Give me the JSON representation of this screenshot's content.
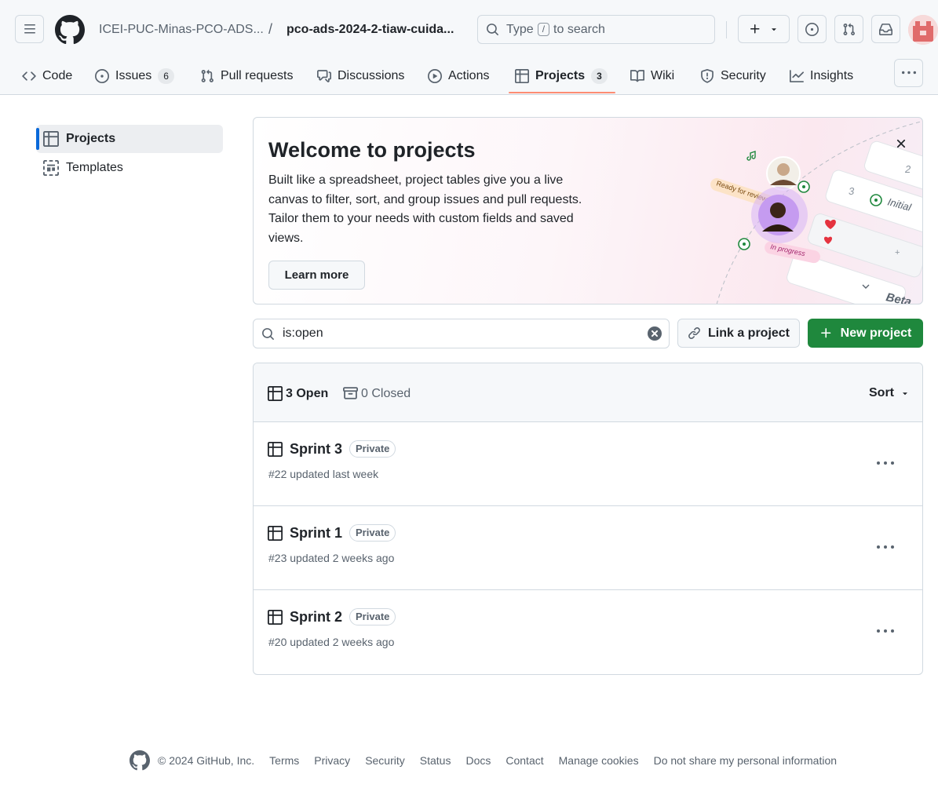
{
  "header": {
    "owner": "ICEI-PUC-Minas-PCO-ADS...",
    "separator": "/",
    "repo": "pco-ads-2024-2-tiaw-cuida...",
    "search": {
      "prefix": "Type",
      "key": "/",
      "suffix": "to search"
    }
  },
  "tabs": [
    {
      "label": "Code",
      "icon": "code-icon"
    },
    {
      "label": "Issues",
      "icon": "issue-opened-icon",
      "count": "6"
    },
    {
      "label": "Pull requests",
      "icon": "git-pull-request-icon"
    },
    {
      "label": "Discussions",
      "icon": "comment-discussion-icon"
    },
    {
      "label": "Actions",
      "icon": "play-icon"
    },
    {
      "label": "Projects",
      "icon": "table-icon",
      "count": "3",
      "active": true
    },
    {
      "label": "Wiki",
      "icon": "book-icon"
    },
    {
      "label": "Security",
      "icon": "shield-icon"
    },
    {
      "label": "Insights",
      "icon": "graph-icon"
    }
  ],
  "sidebar": {
    "items": [
      {
        "label": "Projects",
        "icon": "table-icon",
        "active": true
      },
      {
        "label": "Templates",
        "icon": "project-template-icon"
      }
    ]
  },
  "banner": {
    "title": "Welcome to projects",
    "body": "Built like a spreadsheet, project tables give you a live canvas to filter, sort, and group issues and pull requests. Tailor them to your needs with custom fields and saved views.",
    "learn_more": "Learn more",
    "illustration": {
      "tag_review": "Ready for review",
      "tag_progress": "In progress",
      "cell_2": "2",
      "cell_3": "3",
      "cell_initial": "Initial",
      "cell_beta": "Beta"
    }
  },
  "filter": {
    "value": "is:open"
  },
  "actions": {
    "link_project": "Link a project",
    "new_project": "New project"
  },
  "list": {
    "open_label": "3 Open",
    "closed_label": "0 Closed",
    "sort_label": "Sort",
    "projects": [
      {
        "name": "Sprint 3",
        "visibility": "Private",
        "meta": "#22 updated last week"
      },
      {
        "name": "Sprint 1",
        "visibility": "Private",
        "meta": "#23 updated 2 weeks ago"
      },
      {
        "name": "Sprint 2",
        "visibility": "Private",
        "meta": "#20 updated 2 weeks ago"
      }
    ]
  },
  "footer": {
    "copyright": "© 2024 GitHub, Inc.",
    "links": [
      "Terms",
      "Privacy",
      "Security",
      "Status",
      "Docs",
      "Contact",
      "Manage cookies",
      "Do not share my personal information"
    ]
  },
  "colors": {
    "primary_green": "#1f883d",
    "accent_blue": "#0969da",
    "tab_underline": "#fd8c73",
    "border": "#d1d9e0",
    "muted_text": "#59636e"
  }
}
